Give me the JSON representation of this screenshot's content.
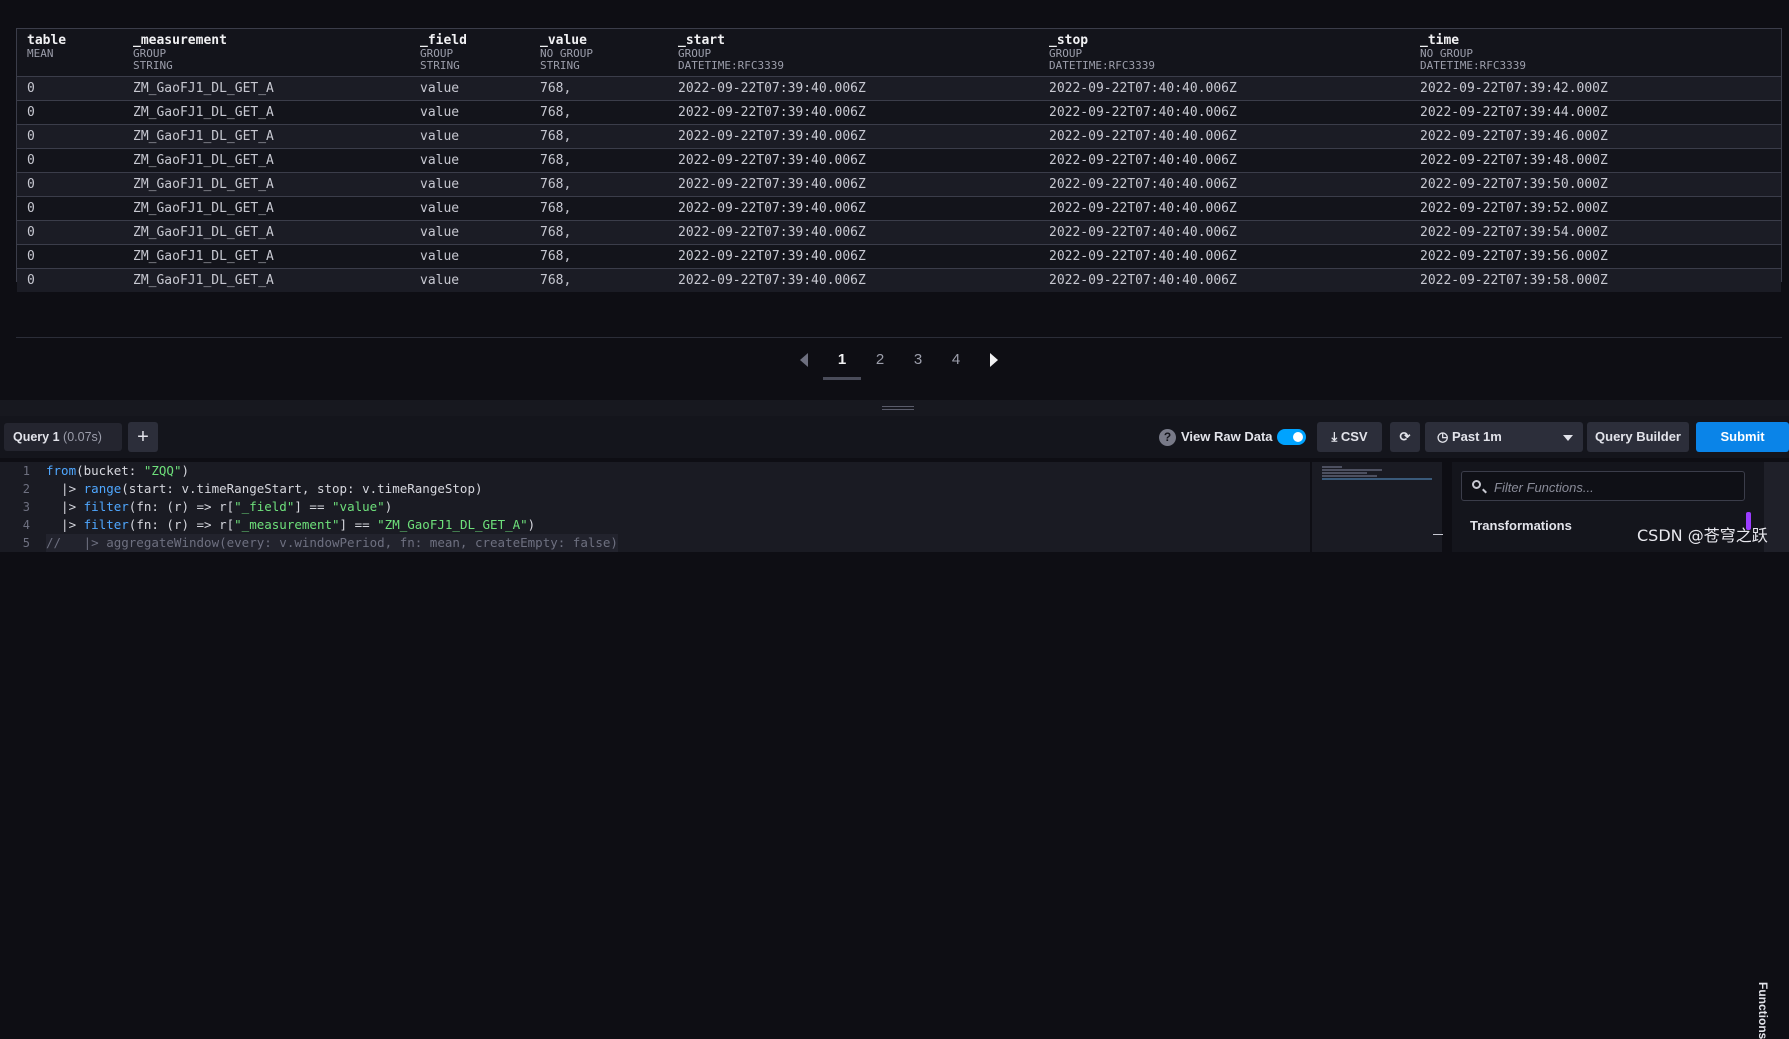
{
  "table": {
    "columns": [
      {
        "name": "table",
        "meta1": "MEAN",
        "meta2": ""
      },
      {
        "name": "_measurement",
        "meta1": "GROUP",
        "meta2": "STRING"
      },
      {
        "name": "_field",
        "meta1": "GROUP",
        "meta2": "STRING"
      },
      {
        "name": "_value",
        "meta1": "NO GROUP",
        "meta2": "STRING"
      },
      {
        "name": "_start",
        "meta1": "GROUP",
        "meta2": "DATETIME:RFC3339"
      },
      {
        "name": "_stop",
        "meta1": "GROUP",
        "meta2": "DATETIME:RFC3339"
      },
      {
        "name": "_time",
        "meta1": "NO GROUP",
        "meta2": "DATETIME:RFC3339"
      }
    ],
    "rows": [
      [
        "0",
        "ZM_GaoFJ1_DL_GET_A",
        "value",
        "768,",
        "2022-09-22T07:39:40.006Z",
        "2022-09-22T07:40:40.006Z",
        "2022-09-22T07:39:42.000Z"
      ],
      [
        "0",
        "ZM_GaoFJ1_DL_GET_A",
        "value",
        "768,",
        "2022-09-22T07:39:40.006Z",
        "2022-09-22T07:40:40.006Z",
        "2022-09-22T07:39:44.000Z"
      ],
      [
        "0",
        "ZM_GaoFJ1_DL_GET_A",
        "value",
        "768,",
        "2022-09-22T07:39:40.006Z",
        "2022-09-22T07:40:40.006Z",
        "2022-09-22T07:39:46.000Z"
      ],
      [
        "0",
        "ZM_GaoFJ1_DL_GET_A",
        "value",
        "768,",
        "2022-09-22T07:39:40.006Z",
        "2022-09-22T07:40:40.006Z",
        "2022-09-22T07:39:48.000Z"
      ],
      [
        "0",
        "ZM_GaoFJ1_DL_GET_A",
        "value",
        "768,",
        "2022-09-22T07:39:40.006Z",
        "2022-09-22T07:40:40.006Z",
        "2022-09-22T07:39:50.000Z"
      ],
      [
        "0",
        "ZM_GaoFJ1_DL_GET_A",
        "value",
        "768,",
        "2022-09-22T07:39:40.006Z",
        "2022-09-22T07:40:40.006Z",
        "2022-09-22T07:39:52.000Z"
      ],
      [
        "0",
        "ZM_GaoFJ1_DL_GET_A",
        "value",
        "768,",
        "2022-09-22T07:39:40.006Z",
        "2022-09-22T07:40:40.006Z",
        "2022-09-22T07:39:54.000Z"
      ],
      [
        "0",
        "ZM_GaoFJ1_DL_GET_A",
        "value",
        "768,",
        "2022-09-22T07:39:40.006Z",
        "2022-09-22T07:40:40.006Z",
        "2022-09-22T07:39:56.000Z"
      ],
      [
        "0",
        "ZM_GaoFJ1_DL_GET_A",
        "value",
        "768,",
        "2022-09-22T07:39:40.006Z",
        "2022-09-22T07:40:40.006Z",
        "2022-09-22T07:39:58.000Z"
      ]
    ]
  },
  "pagination": {
    "pages": [
      "1",
      "2",
      "3",
      "4"
    ],
    "active": "1"
  },
  "toolbar": {
    "query_tab": "Query 1",
    "query_time": "(0.07s)",
    "add_label": "+",
    "help_icon": "?",
    "view_raw_label": "View Raw Data",
    "view_raw_enabled": true,
    "csv_label": "CSV",
    "time_range": "Past 1m",
    "query_builder_label": "Query Builder",
    "submit_label": "Submit"
  },
  "editor": {
    "line_numbers": [
      "1",
      "2",
      "3",
      "4",
      "5"
    ],
    "lines": [
      [
        {
          "t": "from",
          "c": "kw"
        },
        {
          "t": "(bucket: ",
          "c": ""
        },
        {
          "t": "\"ZQQ\"",
          "c": "str"
        },
        {
          "t": ")",
          "c": ""
        }
      ],
      [
        {
          "t": "  |> ",
          "c": ""
        },
        {
          "t": "range",
          "c": "kw"
        },
        {
          "t": "(start: v.timeRangeStart, stop: v.timeRangeStop)",
          "c": ""
        }
      ],
      [
        {
          "t": "  |> ",
          "c": ""
        },
        {
          "t": "filter",
          "c": "kw"
        },
        {
          "t": "(fn: (r) => r[",
          "c": ""
        },
        {
          "t": "\"_field\"",
          "c": "str"
        },
        {
          "t": "] == ",
          "c": ""
        },
        {
          "t": "\"value\"",
          "c": "str"
        },
        {
          "t": ")",
          "c": ""
        }
      ],
      [
        {
          "t": "  |> ",
          "c": ""
        },
        {
          "t": "filter",
          "c": "kw"
        },
        {
          "t": "(fn: (r) => r[",
          "c": ""
        },
        {
          "t": "\"_measurement\"",
          "c": "str"
        },
        {
          "t": "] == ",
          "c": ""
        },
        {
          "t": "\"ZM_GaoFJ1_DL_GET_A\"",
          "c": "str"
        },
        {
          "t": ")",
          "c": ""
        }
      ],
      [
        {
          "t": "//   |> aggregateWindow(every: v.windowPeriod, fn: mean, createEmpty: false)",
          "c": "cm"
        }
      ]
    ]
  },
  "functions_panel": {
    "search_placeholder": "Filter Functions...",
    "section_title": "Transformations",
    "side_tab_label": "Functions"
  },
  "watermark": "CSDN @苍穹之跃",
  "colors": {
    "accent": "#00a3ff",
    "submit": "#0a84e8",
    "keyword": "#4fa7ff",
    "string": "#6ee07b"
  }
}
